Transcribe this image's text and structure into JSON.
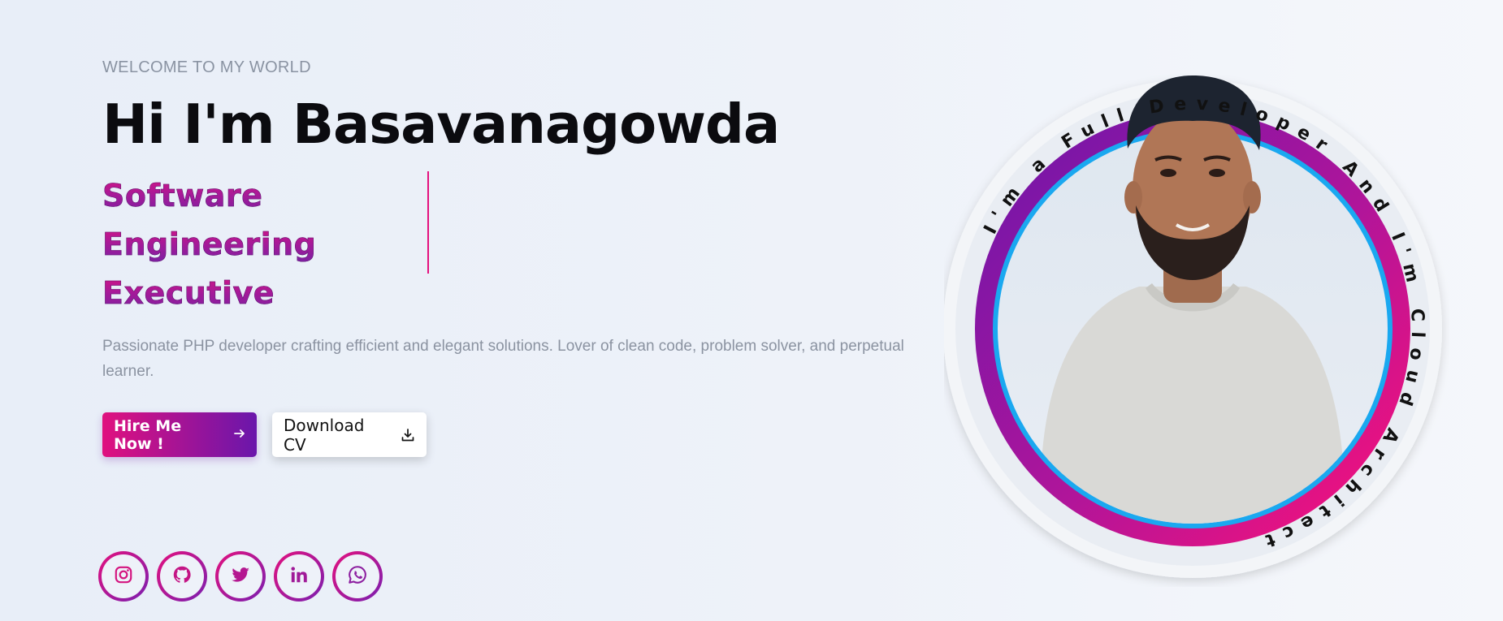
{
  "hero": {
    "kicker": "WELCOME TO MY WORLD",
    "title": "Hi I'm Basavanagowda",
    "roles": [
      "Software",
      "Engineering",
      "Executive"
    ],
    "description": "Passionate PHP developer crafting efficient and elegant solutions. Lover of clean code, problem solver, and perpetual learner."
  },
  "actions": {
    "hire_label": "Hire Me Now !",
    "hire_icon": "arrow-right-icon",
    "download_label": "Download CV",
    "download_icon": "download-icon"
  },
  "socials": [
    {
      "icon": "instagram-icon"
    },
    {
      "icon": "github-icon"
    },
    {
      "icon": "twitter-icon"
    },
    {
      "icon": "linkedin-icon"
    },
    {
      "icon": "whatsapp-icon"
    }
  ],
  "portrait": {
    "circular_text": "I'm a Full Developer And I'm Cloud Architect",
    "alt": "Basavanagowda portrait"
  },
  "colors": {
    "accent_pink": "#e4117e",
    "accent_purple": "#6d22a5",
    "ring_blue": "#1aa8f0"
  }
}
